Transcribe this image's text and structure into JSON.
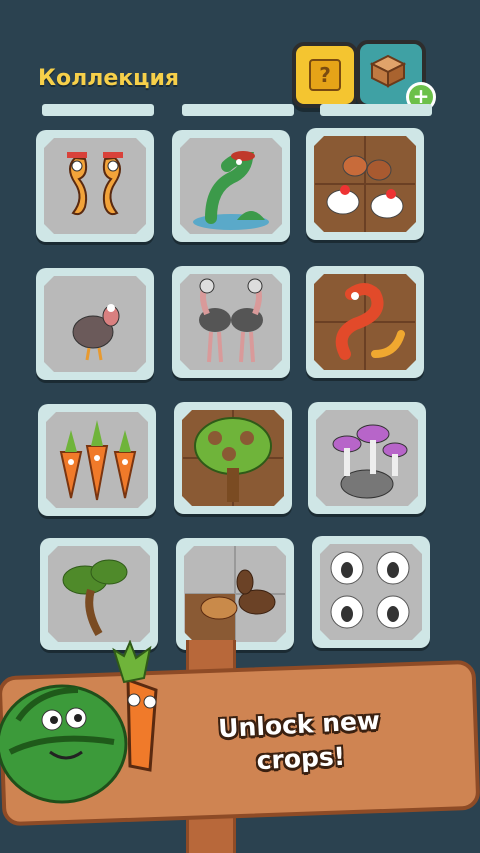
{
  "header": {
    "title": "Коллекция",
    "help_label": "?"
  },
  "sign": {
    "line1": "Unlock new",
    "line2": "crops!"
  },
  "cards": [
    {
      "name": "seahorses-card",
      "icon": "seahorses-icon"
    },
    {
      "name": "sea-serpent-card",
      "icon": "sea-serpent-icon"
    },
    {
      "name": "chickens-card",
      "icon": "chickens-icon"
    },
    {
      "name": "turkey-card",
      "icon": "turkey-icon"
    },
    {
      "name": "ostriches-card",
      "icon": "ostriches-icon"
    },
    {
      "name": "dragon-card",
      "icon": "dragon-icon"
    },
    {
      "name": "carrots-card",
      "icon": "carrots-icon"
    },
    {
      "name": "tree-card",
      "icon": "tree-icon"
    },
    {
      "name": "mushrooms-card",
      "icon": "mushrooms-icon"
    },
    {
      "name": "bonsai-card",
      "icon": "bonsai-icon"
    },
    {
      "name": "horses-card",
      "icon": "horses-icon"
    },
    {
      "name": "sheep-card",
      "icon": "sheep-icon"
    }
  ],
  "colors": {
    "background": "#2b4250",
    "title": "#f7d04a",
    "card_frame": "#cfe6e6",
    "card_inner": "#b9b9b9",
    "help_button": "#f4c530",
    "crate_button": "#3fa1a4",
    "sign_wood": "#cf8452"
  }
}
